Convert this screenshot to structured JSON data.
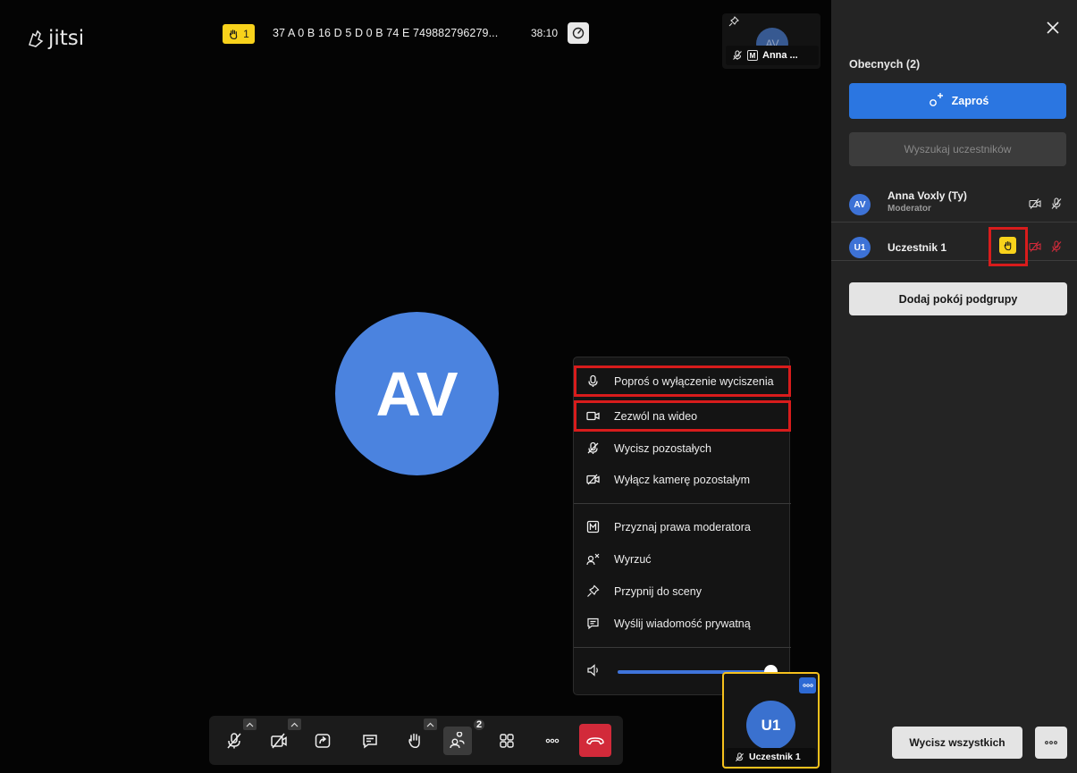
{
  "app": {
    "logo_text": "jitsi"
  },
  "header": {
    "raised_hands_count": "1",
    "meeting_name": "37 A 0 B 16 D 5 D 0 B 74 E 749882796279...",
    "timer": "38:10"
  },
  "stage": {
    "main_avatar_initials": "AV",
    "top_thumbnail": {
      "initials": "AV",
      "name": "Anna ...",
      "moderator_badge": "M"
    },
    "local_thumbnail": {
      "initials": "U1",
      "name": "Uczestnik 1"
    }
  },
  "context_menu": {
    "items": [
      {
        "label": "Poproś o wyłączenie wyciszenia",
        "icon": "microphone-icon"
      },
      {
        "label": "Zezwól na wideo",
        "icon": "camera-icon"
      },
      {
        "label": "Wycisz pozostałych",
        "icon": "mic-muted-icon"
      },
      {
        "label": "Wyłącz kamerę pozostałym",
        "icon": "camera-off-icon"
      },
      {
        "label": "Przyznaj prawa moderatora",
        "icon": "moderator-icon"
      },
      {
        "label": "Wyrzuć",
        "icon": "kick-icon"
      },
      {
        "label": "Przypnij do sceny",
        "icon": "pin-icon"
      },
      {
        "label": "Wyślij wiadomość prywatną",
        "icon": "chat-icon"
      }
    ],
    "volume_level": 1.0
  },
  "toolbar": {
    "buttons": [
      "mic-muted-icon",
      "camera-off-icon",
      "share-screen-icon",
      "chat-icon",
      "raise-hand-icon",
      "participants-icon",
      "tile-view-icon",
      "more-icon",
      "hangup-icon"
    ],
    "participants_badge": "2"
  },
  "participants_panel": {
    "title": "Obecnych (2)",
    "invite_label": "Zaproś",
    "search_placeholder": "Wyszukaj uczestników",
    "participants": [
      {
        "initials": "AV",
        "name": "Anna Voxly (Ty)",
        "role": "Moderator",
        "hand_raised": false
      },
      {
        "initials": "U1",
        "name": "Uczestnik 1",
        "role": "",
        "hand_raised": true
      }
    ],
    "breakout_label": "Dodaj pokój podgrupy",
    "mute_all_label": "Wycisz wszystkich"
  },
  "colors": {
    "accent_blue": "#2b76e1",
    "avatar_blue": "#4b83df",
    "hand_yellow": "#f8d21b",
    "hangup_red": "#d22a3a",
    "highlight_red": "#d81c1c"
  }
}
